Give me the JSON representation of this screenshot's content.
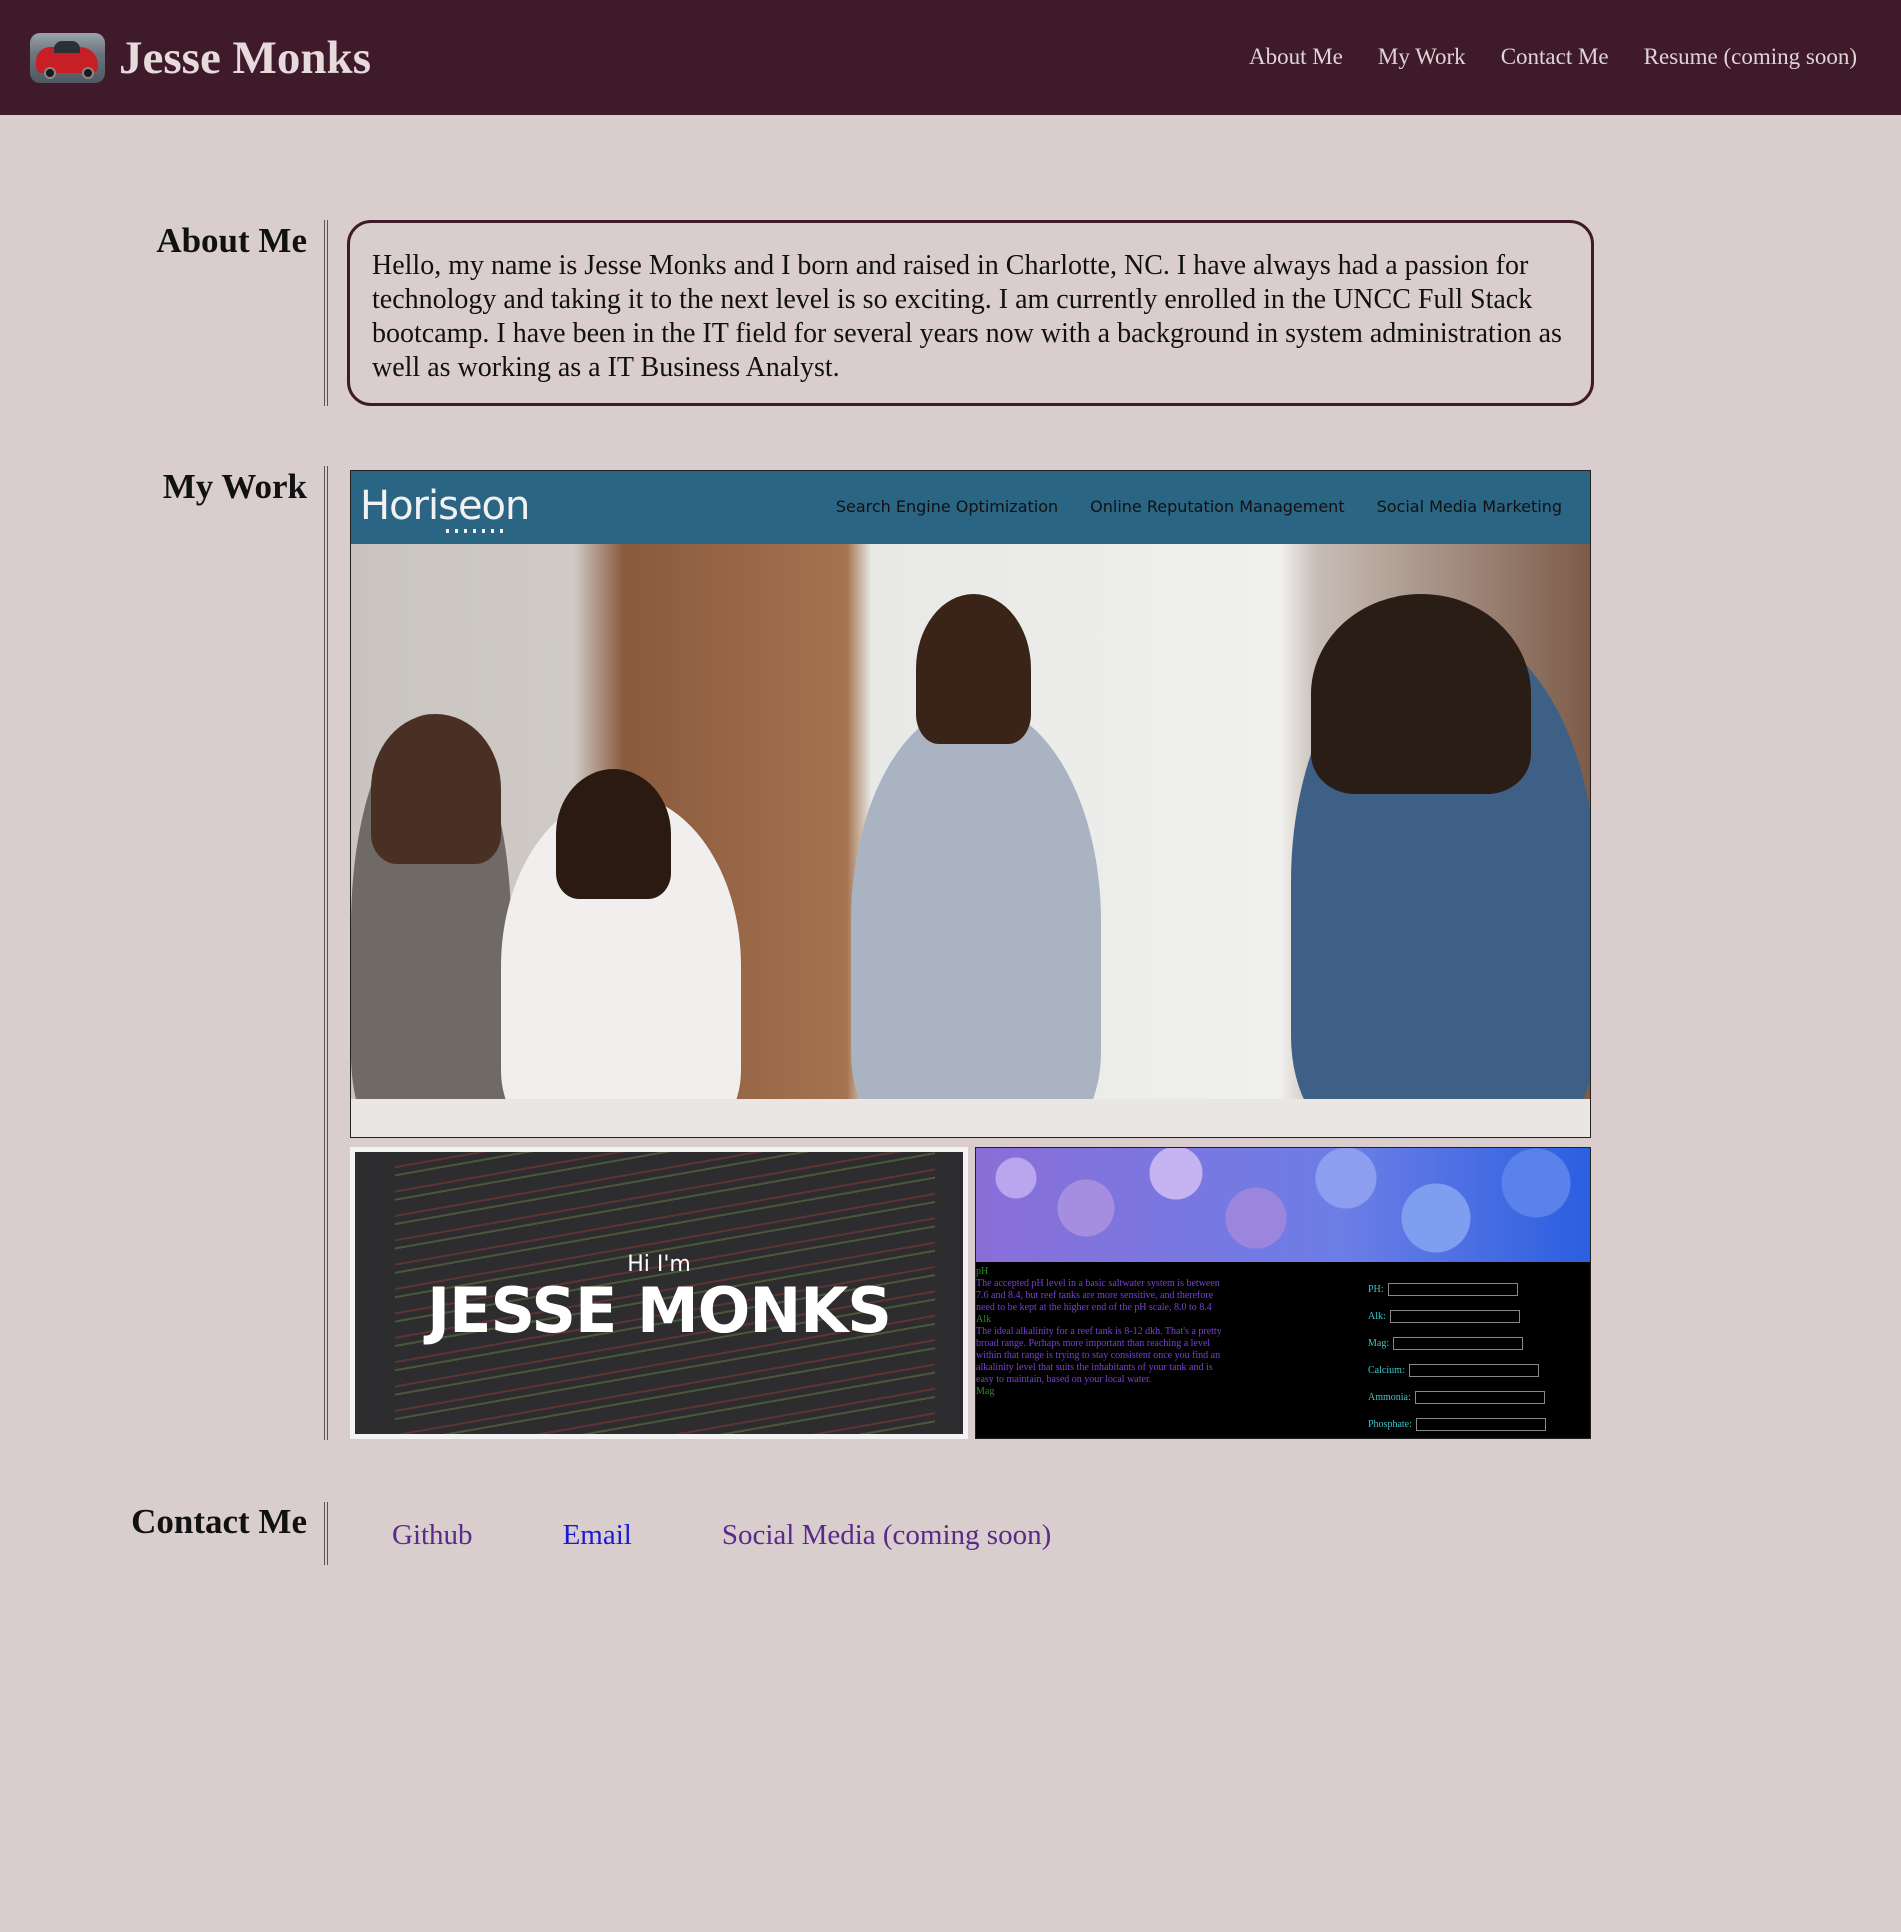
{
  "header": {
    "site_title": "Jesse Monks",
    "logo_icon": "car-photo",
    "nav": [
      {
        "label": "About Me"
      },
      {
        "label": "My Work"
      },
      {
        "label": "Contact Me"
      },
      {
        "label": "Resume (coming soon)"
      }
    ]
  },
  "about": {
    "heading": "About Me",
    "text": "Hello, my name is Jesse Monks and I born and raised in Charlotte, NC. I have always had a passion for technology and taking it to the next level is so exciting. I am currently enrolled in the UNCC Full Stack bootcamp. I have been in the IT field for several years now with a background in system administration as well as working as a IT Business Analyst."
  },
  "work": {
    "heading": "My Work",
    "horiseon": {
      "logo": "Horiseon",
      "nav": [
        "Search Engine Optimization",
        "Online Reputation Management",
        "Social Media Marketing"
      ]
    },
    "portfolio": {
      "greeting": "Hi I'm",
      "name": "JESSE MONKS"
    },
    "aquarium": {
      "ph_heading": "pH",
      "ph_text": "The accepted pH level in a basic saltwater system is between 7.6 and 8.4, but reef tanks are more sensitive, and therefore need to be kept at the higher end of the pH scale, 8.0 to 8.4",
      "alk_heading": "Alk",
      "alk_text": "The ideal alkalinity for a reef tank is 8-12 dkh. That's a pretty broad range. Perhaps more important than reaching a level within that range is trying to stay consistent once you find an alkalinity level that suits the inhabitants of your tank and is easy to maintain, based on your local water.",
      "mag_heading": "Mag",
      "fields": [
        "PH:",
        "Alk:",
        "Mag:",
        "Calcium:",
        "Ammonia:",
        "Phosphate:"
      ]
    }
  },
  "contact": {
    "heading": "Contact Me",
    "links": [
      {
        "label": "Github",
        "color": "#5a2a8a"
      },
      {
        "label": "Email",
        "color": "#1a1ad6"
      },
      {
        "label": "Social Media (coming soon)",
        "color": "#5a2a8a"
      }
    ]
  },
  "colors": {
    "background": "#d9cdcd",
    "header": "#3e1a2b",
    "accent_border": "#3e1a2b"
  }
}
